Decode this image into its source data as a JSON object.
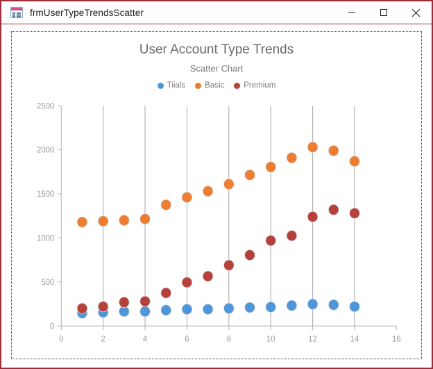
{
  "window": {
    "title": "frmUserTypeTrendsScatter",
    "icon": "access-form-icon",
    "controls": {
      "minimize": "minimize-icon",
      "maximize": "maximize-icon",
      "close": "close-icon"
    },
    "border_color": "#a02b3a"
  },
  "chart_data": {
    "type": "scatter",
    "title": "User Account Type Trends",
    "subtitle": "Scatter Chart",
    "xlabel": "",
    "ylabel": "",
    "xlim": [
      0,
      16
    ],
    "ylim": [
      0,
      2500
    ],
    "xticks": [
      0,
      2,
      4,
      6,
      8,
      10,
      12,
      14,
      16
    ],
    "yticks": [
      0,
      500,
      1000,
      1500,
      2000,
      2500
    ],
    "grid": "vertical",
    "legend_position": "top",
    "x": [
      1,
      2,
      3,
      4,
      5,
      6,
      7,
      8,
      9,
      10,
      11,
      12,
      13,
      14
    ],
    "series": [
      {
        "name": "Tiials",
        "color": "#4E95D9",
        "values": [
          145,
          155,
          165,
          165,
          180,
          190,
          190,
          200,
          210,
          215,
          232,
          248,
          240,
          220
        ]
      },
      {
        "name": "Basic",
        "color": "#ED7D31",
        "values": [
          1180,
          1190,
          1200,
          1215,
          1375,
          1460,
          1530,
          1610,
          1715,
          1805,
          1910,
          2030,
          1990,
          1870
        ]
      },
      {
        "name": "Premium",
        "color": "#B5413A",
        "values": [
          200,
          220,
          270,
          280,
          375,
          495,
          565,
          690,
          805,
          970,
          1025,
          1240,
          1320,
          1280
        ]
      }
    ]
  }
}
